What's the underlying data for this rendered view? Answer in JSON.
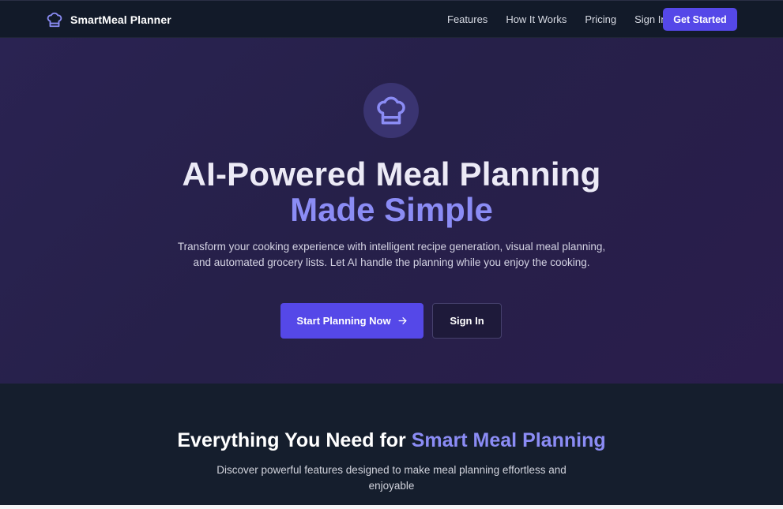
{
  "nav": {
    "brand": "SmartMeal Planner",
    "brand_icon": "chef-hat-icon",
    "links": [
      "Features",
      "How It Works",
      "Pricing",
      "Sign In"
    ],
    "cta": "Get Started"
  },
  "hero": {
    "icon": "chef-hat-icon",
    "title_line1": "AI-Powered Meal Planning",
    "title_line2": "Made Simple",
    "subtitle": "Transform your cooking experience with intelligent recipe generation, visual meal planning, and automated grocery lists. Let AI handle the planning while you enjoy the cooking.",
    "primary_button": "Start Planning Now",
    "primary_button_icon": "arrow-right-icon",
    "secondary_button": "Sign In"
  },
  "features": {
    "title_prefix": "Everything You Need for ",
    "title_accent": "Smart Meal Planning",
    "subtitle": "Discover powerful features designed to make meal planning effortless and enjoyable"
  },
  "colors": {
    "accent": "#5548e8",
    "accent_text": "#8b8cf5",
    "nav_bg": "#121a29",
    "hero_bg": "#262049",
    "section_bg": "#151e2d"
  }
}
